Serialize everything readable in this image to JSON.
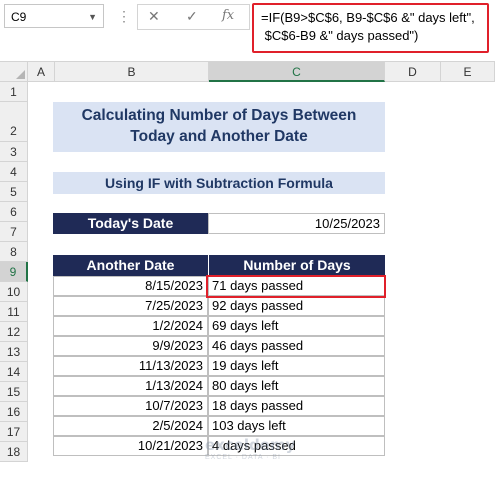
{
  "formula_bar": {
    "name_box": "C9",
    "cancel_icon": "✕",
    "enter_icon": "✓",
    "fx_label": "fx",
    "formula_line1": "=IF(B9>$C$6, B9-$C$6 &\" days left\",",
    "formula_line2": " $C$6-B9 &\" days passed\")"
  },
  "columns": [
    "A",
    "B",
    "C",
    "D",
    "E"
  ],
  "selected_column": "C",
  "rows": [
    "1",
    "2",
    "3",
    "4",
    "5",
    "6",
    "7",
    "8",
    "9",
    "10",
    "11",
    "12",
    "13",
    "14",
    "15",
    "16",
    "17",
    "18"
  ],
  "selected_row": "9",
  "sheet": {
    "title_line1": "Calculating Number of Days Between",
    "title_line2": "Today and Another Date",
    "subtitle": "Using IF with Subtraction Formula",
    "today_label": "Today's Date",
    "today_value": "10/25/2023",
    "table_headers": [
      "Another Date",
      "Number of Days"
    ],
    "table_rows": [
      {
        "date": "8/15/2023",
        "days": "71 days passed"
      },
      {
        "date": "7/25/2023",
        "days": "92 days passed"
      },
      {
        "date": "1/2/2024",
        "days": "69 days left"
      },
      {
        "date": "9/9/2023",
        "days": "46 days passed"
      },
      {
        "date": "11/13/2023",
        "days": "19 days left"
      },
      {
        "date": "1/13/2024",
        "days": "80 days left"
      },
      {
        "date": "10/7/2023",
        "days": "18 days passed"
      },
      {
        "date": "2/5/2024",
        "days": "103 days left"
      },
      {
        "date": "10/21/2023",
        "days": "4 days passed"
      }
    ]
  },
  "watermark": {
    "name": "exceldemy",
    "tagline": "EXCEL · DATA · BI"
  },
  "colors": {
    "header_dark": "#1f2a56",
    "title_bg": "#dae3f3",
    "title_text": "#203864",
    "highlight": "#e0202a",
    "excel_green": "#217346"
  }
}
